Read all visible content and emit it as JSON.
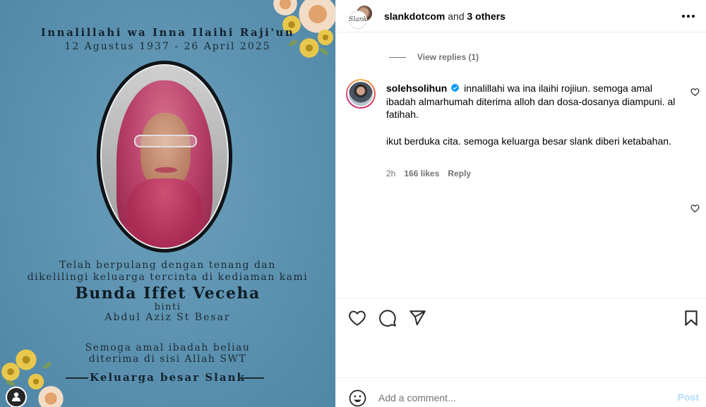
{
  "image": {
    "prayer": "Innalillahi wa Inna Ilaihi Raji'un",
    "dates": "12 Agustus 1937 - 26 April 2025",
    "passed_line1": "Telah berpulang dengan tenang dan",
    "passed_line2": "dikelilingi keluarga tercinta di kediaman kami",
    "name": "Bunda Iffet Veceha",
    "binti": "binti",
    "father": "Abdul Aziz St Besar",
    "pray_line1": "Semoga amal ibadah beliau",
    "pray_line2": "diterima di sisi Allah SWT",
    "family": "Keluarga besar Slank"
  },
  "header": {
    "username": "slankdotcom",
    "joiner": "and",
    "others": "3 others",
    "logo_text": "Slank"
  },
  "replies": {
    "label": "View replies (1)"
  },
  "comment": {
    "username": "solehsolihun",
    "text1": "innalillahi wa ina ilaihi rojiiun. semoga amal ibadah almarhumah diterima alloh dan dosa-dosanya diampuni. al fatihah.",
    "text2": "ikut berduka cita. semoga keluarga besar slank diberi ketabahan.",
    "time": "2h",
    "likes": "166 likes",
    "reply": "Reply"
  },
  "composer": {
    "placeholder": "Add a comment...",
    "post_label": "Post"
  },
  "colors": {
    "link_blue": "#0095f6",
    "post_disabled": "#b3dbff",
    "muted": "#737373"
  }
}
